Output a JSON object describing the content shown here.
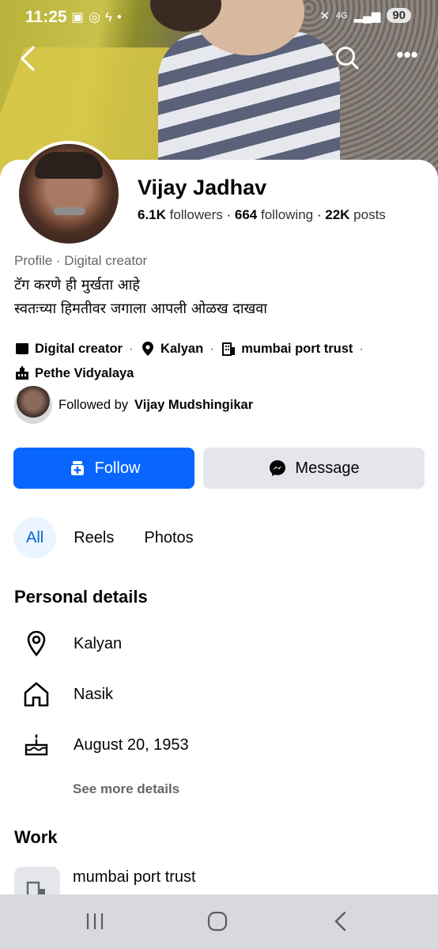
{
  "status_bar": {
    "time": "11:25",
    "network": "4G",
    "battery": "90"
  },
  "profile": {
    "name": "Vijay Jadhav",
    "followers_count": "6.1K",
    "followers_label": "followers",
    "following_count": "664",
    "following_label": "following",
    "posts_count": "22K",
    "posts_label": "posts",
    "subtitle": "Profile · Digital creator",
    "bio_line1": "टॅग करणे ही मुर्खता आहे",
    "bio_line2": "स्वतःच्या हिमतीवर जगाला आपली ओळख दाखवा"
  },
  "tags": {
    "category": "Digital creator",
    "location": "Kalyan",
    "work": "mumbai port trust",
    "education": "Pethe Vidyalaya"
  },
  "followed_by": {
    "prefix": "Followed by",
    "name": "Vijay Mudshingikar"
  },
  "buttons": {
    "follow": "Follow",
    "message": "Message"
  },
  "tabs": [
    "All",
    "Reels",
    "Photos"
  ],
  "personal_details": {
    "title": "Personal details",
    "current_city": "Kalyan",
    "hometown": "Nasik",
    "birthday": "August 20, 1953",
    "see_more": "See more details"
  },
  "work": {
    "title": "Work",
    "employer": "mumbai port trust"
  },
  "colors": {
    "accent": "#0866ff",
    "secondary_button": "#e4e6eb",
    "active_tab_bg": "#ebf5ff",
    "muted_text": "#65676b"
  }
}
